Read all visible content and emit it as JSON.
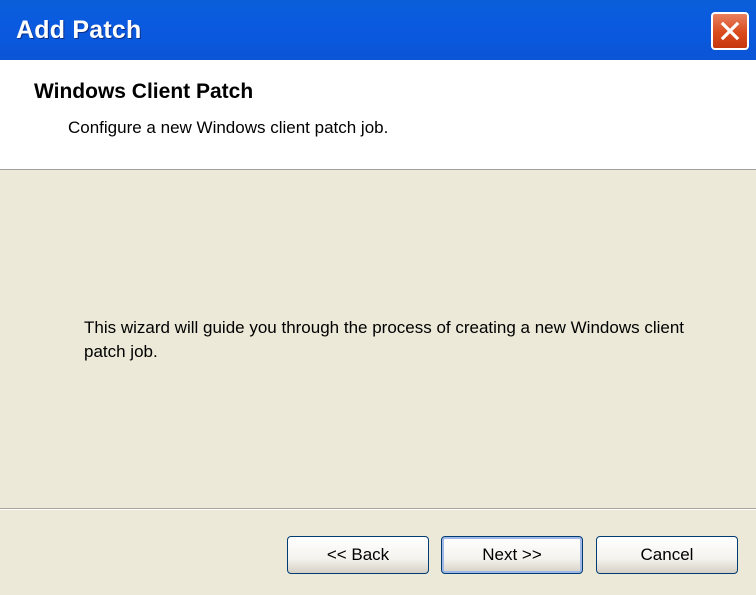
{
  "window": {
    "title": "Add Patch",
    "close_label": "close"
  },
  "header": {
    "title": "Windows Client Patch",
    "subtitle": "Configure a new Windows client patch job."
  },
  "main": {
    "body_text": "This wizard will guide you through the process of creating a new Windows client patch job."
  },
  "buttons": {
    "back_label": "<< Back",
    "next_label": "Next >>",
    "cancel_label": "Cancel"
  },
  "colors": {
    "titlebar": "#0a5ae0",
    "dialog_background": "#ece9d8",
    "close_button": "#d94a1c"
  }
}
